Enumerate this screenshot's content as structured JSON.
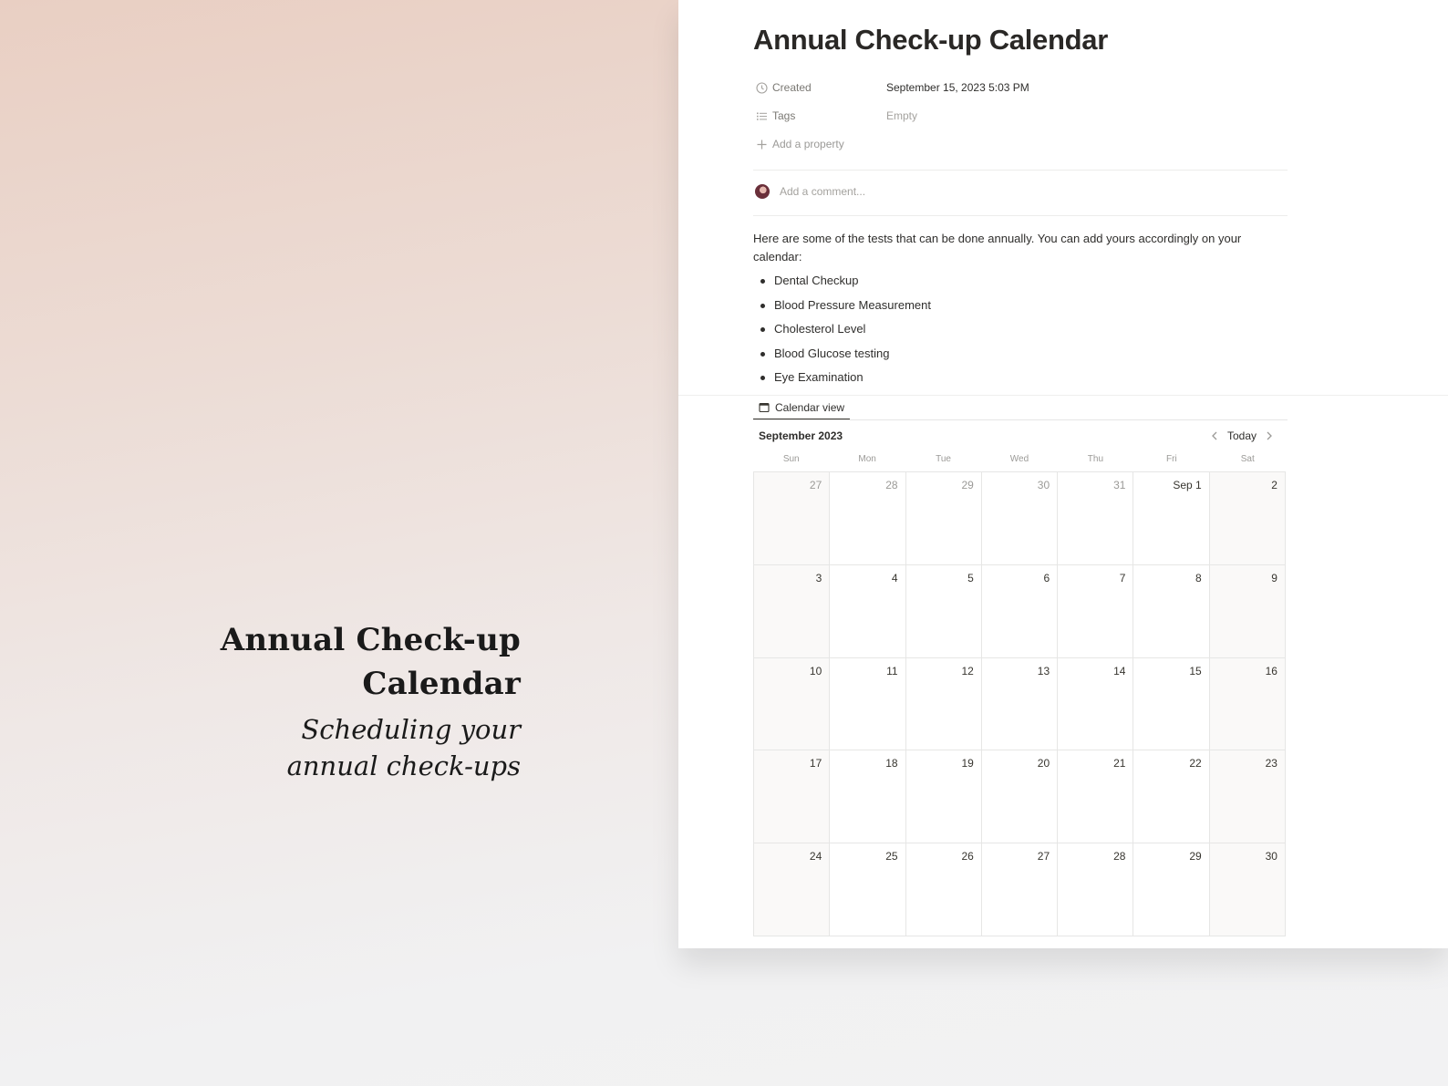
{
  "promo": {
    "title_line1": "Annual Check-up",
    "title_line2": "Calendar",
    "subtitle_line1": "Scheduling your",
    "subtitle_line2": "annual check-ups"
  },
  "page": {
    "title": "Annual Check-up Calendar",
    "properties": [
      {
        "icon": "clock-icon",
        "label": "Created",
        "value": "September 15, 2023 5:03 PM"
      },
      {
        "icon": "list-icon",
        "label": "Tags",
        "value": "Empty"
      }
    ],
    "add_property": "Add a property",
    "comment_placeholder": "Add a comment...",
    "intro": "Here are some of the tests that can be done annually. You can add yours accordingly on your calendar:",
    "tests": [
      "Dental Checkup",
      "Blood Pressure Measurement",
      "Cholesterol Level",
      "Blood Glucose testing",
      "Eye Examination"
    ]
  },
  "calendar": {
    "view_tab": "Calendar view",
    "month": "September 2023",
    "today_label": "Today",
    "weekdays": [
      "Sun",
      "Mon",
      "Tue",
      "Wed",
      "Thu",
      "Fri",
      "Sat"
    ],
    "weeks": [
      [
        "27",
        "28",
        "29",
        "30",
        "31",
        "Sep 1",
        "2"
      ],
      [
        "3",
        "4",
        "5",
        "6",
        "7",
        "8",
        "9"
      ],
      [
        "10",
        "11",
        "12",
        "13",
        "14",
        "15",
        "16"
      ],
      [
        "17",
        "18",
        "19",
        "20",
        "21",
        "22",
        "23"
      ],
      [
        "24",
        "25",
        "26",
        "27",
        "28",
        "29",
        "30"
      ]
    ],
    "outside_month_days": 5
  }
}
